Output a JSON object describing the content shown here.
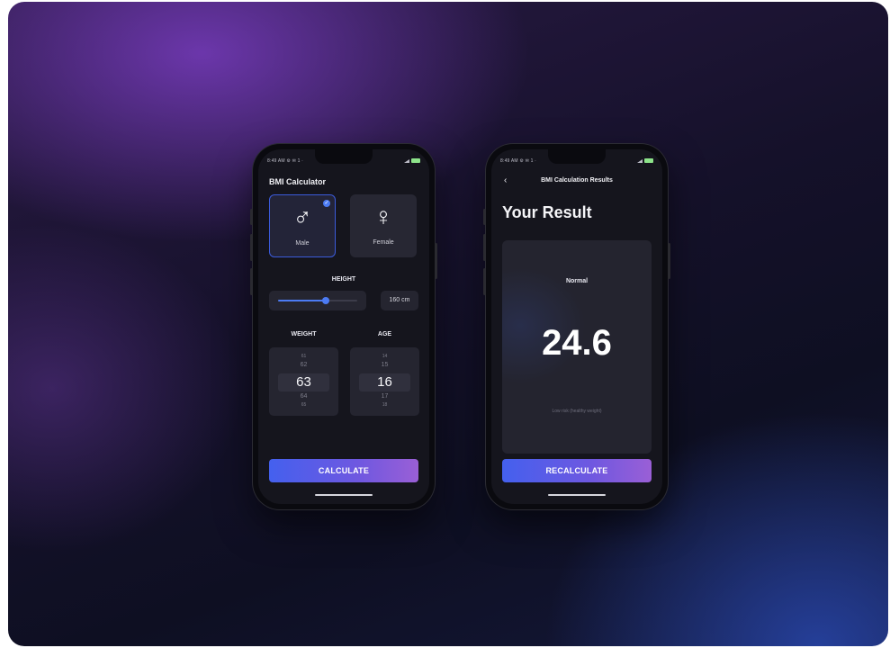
{
  "left_phone": {
    "status": {
      "time": "8:49 AM ⚙ ✉ 1 ·",
      "signal_text": "◢ ✦"
    },
    "app_title": "BMI Calculator",
    "gender": {
      "male": {
        "symbol": "♂",
        "label": "Male",
        "selected": true
      },
      "female": {
        "symbol": "♀",
        "label": "Female",
        "selected": false
      }
    },
    "height": {
      "label": "HEIGHT",
      "value_text": "160 cm",
      "slider_fraction": 0.6
    },
    "weight": {
      "label": "WEIGHT",
      "above2": "61",
      "above": "62",
      "selected": "63",
      "below": "64",
      "below2": "65"
    },
    "age": {
      "label": "AGE",
      "above2": "14",
      "above": "15",
      "selected": "16",
      "below": "17",
      "below2": "18"
    },
    "cta_label": "CALCULATE"
  },
  "right_phone": {
    "status": {
      "time": "8:49 AM ⚙ ✉ 1 ·",
      "signal_text": "◢ ✦"
    },
    "back_icon": "‹",
    "header_title": "BMI Calculation Results",
    "page_title": "Your Result",
    "result": {
      "status": "Normal",
      "value": "24.6",
      "description": "Low risk (healthy weight)"
    },
    "cta_label": "RECALCULATE"
  },
  "colors": {
    "accent": "#4c7bf3",
    "gradient_start": "#4460ee",
    "gradient_end": "#9a5fd6"
  },
  "icons": {
    "male": "male-symbol-icon",
    "female": "female-symbol-icon",
    "check": "check-icon",
    "back": "chevron-left-icon"
  }
}
